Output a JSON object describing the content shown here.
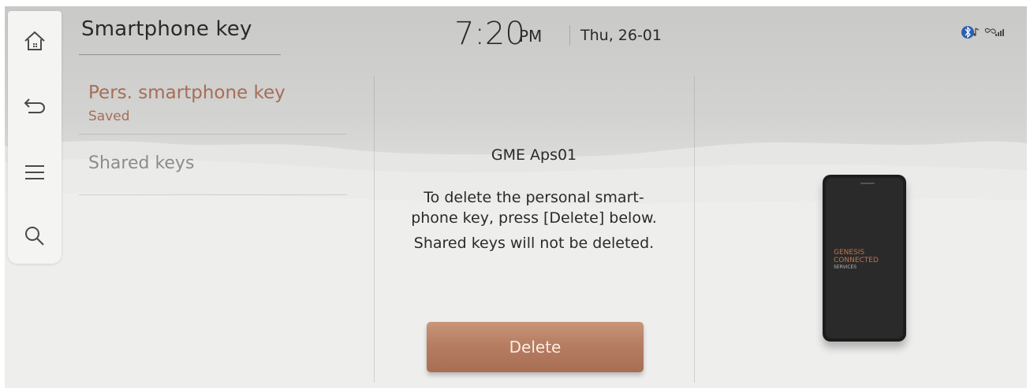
{
  "header": {
    "title": "Smartphone key",
    "time": "7:20",
    "ampm": "PM",
    "date": "Thu, 26-01"
  },
  "rail": {
    "icons": [
      "home-icon",
      "back-icon",
      "menu-icon",
      "search-icon"
    ]
  },
  "status": {
    "icons": [
      "bluetooth-audio-icon",
      "connected-signal-icon"
    ]
  },
  "list": {
    "items": [
      {
        "label": "Pers. smartphone key",
        "sublabel": "Saved",
        "active": true
      },
      {
        "label": "Shared keys",
        "active": false
      }
    ]
  },
  "detail": {
    "device_name": "GME Aps01",
    "message_lines": [
      "To delete the personal smart-",
      "phone key, press [Delete] below.",
      "Shared keys will not be deleted."
    ],
    "delete_label": "Delete"
  },
  "phone": {
    "brand_line1": "GENESIS",
    "brand_line2": "CONNECTED",
    "brand_line3": "SERVICES"
  },
  "colors": {
    "accent": "#a56e58",
    "button": "#b67d62",
    "text": "#2a2a2a",
    "muted": "#8c8c8c"
  }
}
